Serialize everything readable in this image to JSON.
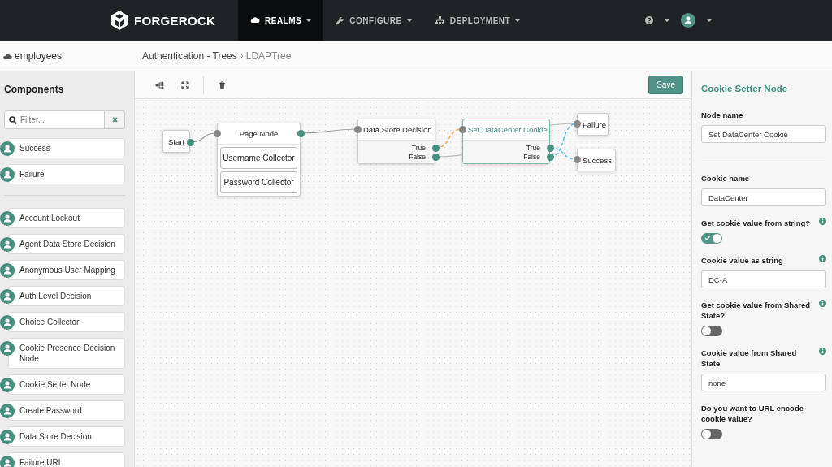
{
  "navbar": {
    "brand": "FORGEROCK",
    "tabs": [
      {
        "label": "REALMS",
        "selected": true
      },
      {
        "label": "CONFIGURE",
        "selected": false
      },
      {
        "label": "DEPLOYMENT",
        "selected": false
      }
    ]
  },
  "subheader": {
    "realm": "employees",
    "breadcrumb": [
      "Authentication - Trees",
      "LDAPTree"
    ]
  },
  "components": {
    "title": "Components",
    "filter": {
      "placeholder": "Filter..."
    },
    "groups": [
      [
        {
          "label": "Success"
        },
        {
          "label": "Failure"
        }
      ],
      [
        {
          "label": "Account Lockout"
        },
        {
          "label": "Agent Data Store Decision"
        },
        {
          "label": "Anonymous User Mapping"
        },
        {
          "label": "Auth Level Decision"
        },
        {
          "label": "Choice Collector"
        },
        {
          "label": "Cookie Presence Decision Node"
        },
        {
          "label": "Cookie Setter Node"
        },
        {
          "label": "Create Password"
        },
        {
          "label": "Data Store Decision"
        },
        {
          "label": "Failure URL"
        }
      ]
    ]
  },
  "toolbar": {
    "save": "Save"
  },
  "tree": {
    "nodes": [
      {
        "title": "Start",
        "kind": "start",
        "selected": false
      },
      {
        "title": "Page Node",
        "kind": "page",
        "selected": false,
        "children": [
          "Username Collector",
          "Password Collector"
        ]
      },
      {
        "title": "Data Store Decision",
        "kind": "decision",
        "selected": false,
        "outcomes": [
          "True",
          "False"
        ]
      },
      {
        "title": "Set DataCenter Cookie",
        "kind": "decision",
        "selected": true,
        "outcomes": [
          "True",
          "False"
        ]
      },
      {
        "title": "Failure",
        "kind": "end",
        "selected": false
      },
      {
        "title": "Success",
        "kind": "end",
        "selected": false
      }
    ]
  },
  "properties": {
    "title": "Cookie Setter Node",
    "fields": [
      {
        "kind": "text",
        "label": "Node name",
        "value": "Set DataCenter Cookie",
        "info": false
      },
      {
        "kind": "text",
        "label": "Cookie name",
        "value": "DataCenter",
        "info": false
      },
      {
        "kind": "toggle",
        "label": "Get cookie value from string?",
        "on": true,
        "info": true
      },
      {
        "kind": "text",
        "label": "Cookie value as string",
        "value": "DC-A",
        "info": true
      },
      {
        "kind": "toggle",
        "label": "Get cookie value from Shared State?",
        "on": false,
        "info": true
      },
      {
        "kind": "text",
        "label": "Cookie value from Shared State",
        "value": "none",
        "info": true
      },
      {
        "kind": "toggle",
        "label": "Do you want to URL encode cookie value?",
        "on": false,
        "info": false
      }
    ]
  }
}
